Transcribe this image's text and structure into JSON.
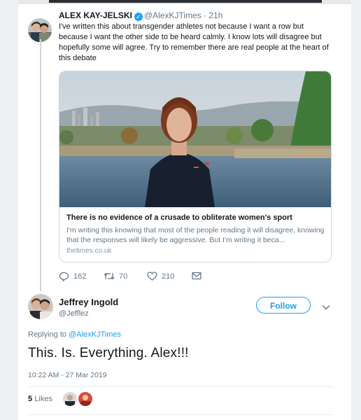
{
  "tweet1": {
    "author_name": "ALEX KAY-JELSKI",
    "handle": "@AlexKJTimes",
    "separator": "·",
    "time": "21h",
    "text": "I've written this about transgender athletes not because I want a row but because I want the other side to be heard calmly. I know lots will disagree but hopefully some will agree. Try to remember there are real people at the heart of this debate",
    "link_card": {
      "title": "There is no evidence of a crusade to obliterate women's sport",
      "description": "I'm writing this knowing that most of the people reading it will disagree, knowing that the responses will likely be aggressive. But I'm writing it beca...",
      "domain": "thetimes.co.uk"
    },
    "actions": {
      "replies": "162",
      "retweets": "70",
      "likes": "210"
    }
  },
  "tweet2": {
    "author_name": "Jeffrey Ingold",
    "handle": "@Jefflez",
    "follow_label": "Follow",
    "replying_prefix": "Replying to",
    "replying_handle": "@AlexKJTimes",
    "text": "This. Is. Everything. Alex!!!",
    "timestamp": "10:22 AM - 27 Mar 2019",
    "likes_count": "5",
    "likes_label": "Likes"
  },
  "colors": {
    "accent": "#1da1f2",
    "text": "#14171a",
    "muted": "#657786",
    "border": "#ccd6dd"
  },
  "icons": [
    "verified-icon",
    "reply-icon",
    "retweet-icon",
    "like-icon",
    "direct-message-icon",
    "chevron-down-icon"
  ]
}
